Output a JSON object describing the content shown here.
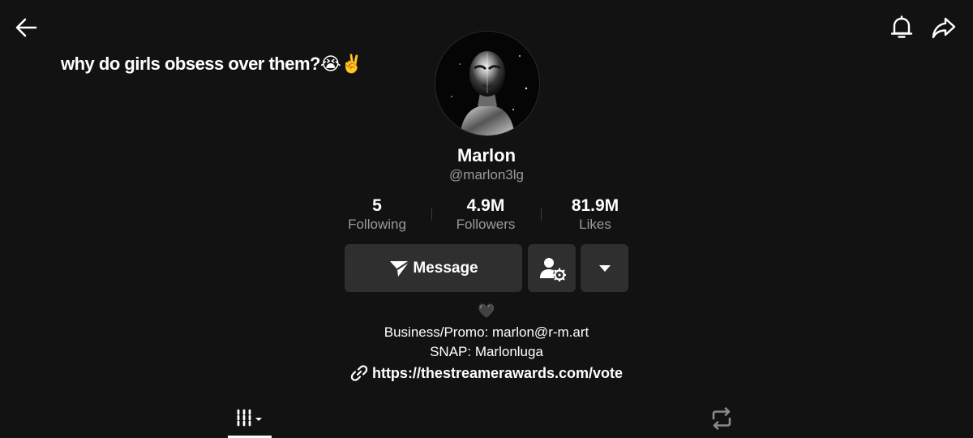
{
  "header": {
    "back_icon": "arrow-left-icon",
    "bell_icon": "bell-icon",
    "share_icon": "share-icon"
  },
  "note": {
    "text": "why do girls obsess over them?😭✌️"
  },
  "profile": {
    "display_name": "Marlon",
    "username": "@marlon3lg"
  },
  "stats": [
    {
      "value": "5",
      "label": "Following"
    },
    {
      "value": "4.9M",
      "label": "Followers"
    },
    {
      "value": "81.9M",
      "label": "Likes"
    }
  ],
  "actions": {
    "message_label": "Message",
    "friend_icon": "add-friend-icon",
    "more_icon": "caret-down-icon"
  },
  "bio": {
    "heart": "🖤",
    "line1": "Business/Promo: marlon@r-m.art",
    "line2": "SNAP: Marlonluga",
    "link": "https://thestreamerawards.com/vote"
  },
  "tabs": [
    {
      "name": "videos",
      "icon": "grid-icon",
      "active": true
    },
    {
      "name": "reposts",
      "icon": "repost-icon",
      "active": false
    }
  ],
  "colors": {
    "background": "#121212",
    "button": "#2f2f2f",
    "muted_text": "#9a9a9a",
    "text": "#ffffff"
  }
}
